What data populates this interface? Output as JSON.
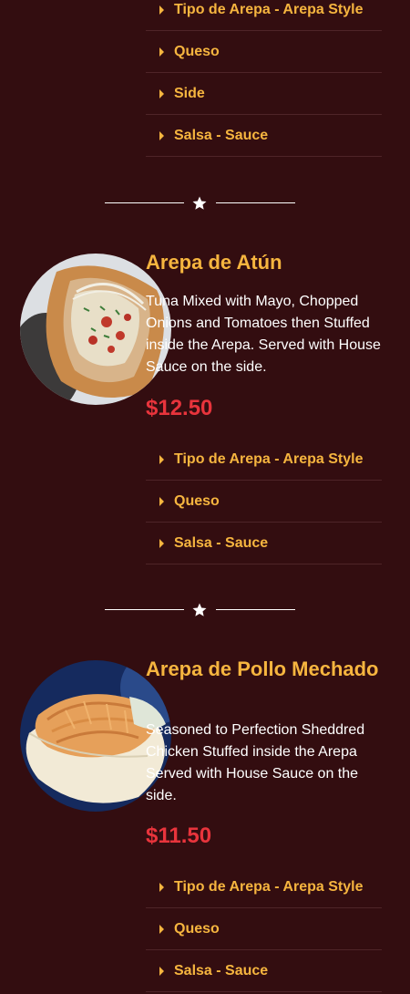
{
  "top_options": [
    {
      "label": "Tipo de Arepa - Arepa Style"
    },
    {
      "label": "Queso"
    },
    {
      "label": "Side"
    },
    {
      "label": "Salsa - Sauce"
    }
  ],
  "items": [
    {
      "name": "Arepa de Atún",
      "description": "Tuna Mixed with Mayo, Chopped Onions and Tomatoes then Stuffed inside the Arepa. Served with House Sauce on the side.",
      "price": "$12.50",
      "options": [
        {
          "label": "Tipo de Arepa - Arepa Style"
        },
        {
          "label": "Queso"
        },
        {
          "label": "Salsa - Sauce"
        }
      ]
    },
    {
      "name": "Arepa de Pollo Mechado",
      "description": "Seasoned to Perfection Sheddred Chicken Stuffed inside the Arepa Served with House Sauce on the side.",
      "price": "$11.50",
      "options": [
        {
          "label": "Tipo de Arepa - Arepa Style"
        },
        {
          "label": "Queso"
        },
        {
          "label": "Salsa - Sauce"
        }
      ]
    }
  ],
  "colors": {
    "background": "#330d10",
    "accent": "#f6b53f",
    "price": "#e8343c",
    "text": "#ffffff"
  },
  "icons": {
    "divider": "star-icon",
    "option": "caret-right-icon"
  }
}
